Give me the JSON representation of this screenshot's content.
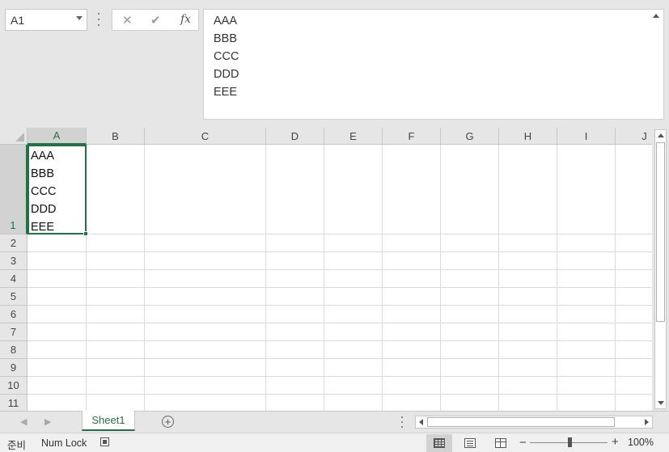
{
  "formula_bar": {
    "name_box": "A1",
    "cancel_symbol": "✕",
    "enter_symbol": "✔",
    "fx_symbol": "fx",
    "content_lines": [
      "AAA",
      "BBB",
      "CCC",
      "DDD",
      "EEE"
    ]
  },
  "grid": {
    "columns": [
      "A",
      "B",
      "C",
      "D",
      "E",
      "F",
      "G",
      "H",
      "I",
      "J"
    ],
    "selected_column": "A",
    "rows": [
      "1",
      "2",
      "3",
      "4",
      "5",
      "6",
      "7",
      "8",
      "9",
      "10",
      "11"
    ],
    "selected_row": "1",
    "active_cell": "A1",
    "cell_a1_lines": [
      "AAA",
      "BBB",
      "CCC",
      "DDD",
      "EEE"
    ]
  },
  "sheet_tabs": {
    "tabs": [
      "Sheet1"
    ],
    "active": "Sheet1",
    "add_symbol": "+",
    "prev_symbol": "◀",
    "next_symbol": "▶"
  },
  "status_bar": {
    "ready": "준비",
    "num_lock": "Num Lock",
    "zoom": "100%",
    "zoom_minus": "−",
    "zoom_plus": "+"
  },
  "icons": [
    "name-box-dropdown-icon",
    "cancel-icon",
    "enter-icon",
    "insert-function-icon",
    "formula-collapse-icon",
    "select-all-icon",
    "scroll-up-icon",
    "scroll-down-icon",
    "scroll-left-icon",
    "scroll-right-icon",
    "add-sheet-icon",
    "macro-record-icon",
    "normal-view-icon",
    "page-layout-icon",
    "page-break-icon"
  ],
  "colors": {
    "accent": "#217346",
    "chrome": "#e6e6e6"
  }
}
